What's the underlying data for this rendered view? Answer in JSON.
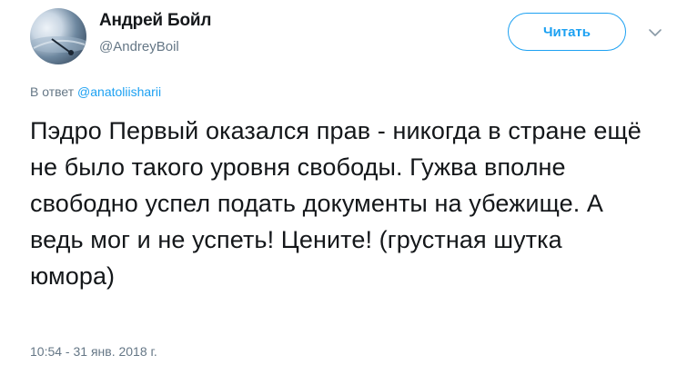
{
  "author": {
    "name": "Андрей Бойл",
    "handle": "@AndreyBoil"
  },
  "follow_button": {
    "label": "Читать",
    "accent": "#1da1f2"
  },
  "reply": {
    "prefix": "В ответ",
    "mention": "@anatoliisharii"
  },
  "tweet": {
    "text": "Пэдро Первый оказался прав - никогда в стране ещё не было такого уровня свободы. Гужва вполне свободно успел подать документы на убежище. А ведь мог и не успеть! Цените! (грустная шутка юмора)",
    "timestamp": "10:54 - 31 янв. 2018 г."
  },
  "icons": {
    "menu": "chevron-down-icon"
  },
  "colors": {
    "text": "#14171a",
    "secondary": "#657786",
    "link": "#1da1f2"
  }
}
